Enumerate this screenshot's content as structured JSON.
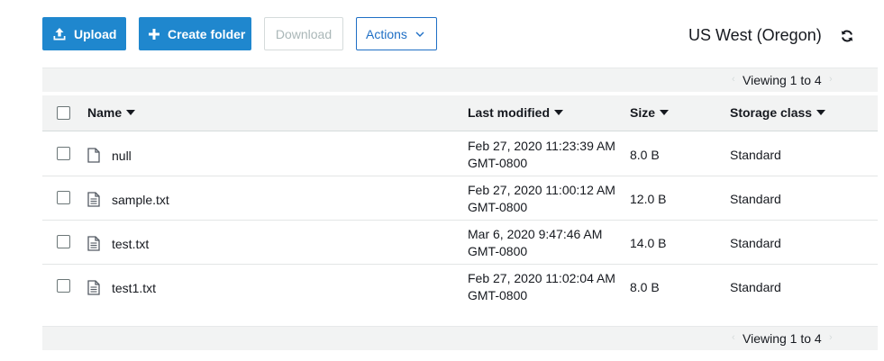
{
  "toolbar": {
    "upload_label": "Upload",
    "create_folder_label": "Create folder",
    "download_label": "Download",
    "actions_label": "Actions"
  },
  "region": "US West (Oregon)",
  "pager": {
    "top_text": "Viewing 1 to 4",
    "bottom_text": "Viewing 1 to 4"
  },
  "table": {
    "columns": {
      "name": "Name",
      "last_modified": "Last modified",
      "size": "Size",
      "storage_class": "Storage class"
    },
    "rows": [
      {
        "name": "null",
        "icon": "blank-file-icon",
        "modified_line1": "Feb 27, 2020 11:23:39 AM",
        "modified_line2": "GMT-0800",
        "size": "8.0 B",
        "storage_class": "Standard"
      },
      {
        "name": "sample.txt",
        "icon": "text-file-icon",
        "modified_line1": "Feb 27, 2020 11:00:12 AM",
        "modified_line2": "GMT-0800",
        "size": "12.0 B",
        "storage_class": "Standard"
      },
      {
        "name": "test.txt",
        "icon": "text-file-icon",
        "modified_line1": "Mar 6, 2020 9:47:46 AM",
        "modified_line2": "GMT-0800",
        "size": "14.0 B",
        "storage_class": "Standard"
      },
      {
        "name": "test1.txt",
        "icon": "text-file-icon",
        "modified_line1": "Feb 27, 2020 11:02:04 AM",
        "modified_line2": "GMT-0800",
        "size": "8.0 B",
        "storage_class": "Standard"
      }
    ]
  },
  "colors": {
    "primary": "#1f87ce",
    "actions_border": "#1f6fc5",
    "header_bg": "#f2f3f3"
  }
}
